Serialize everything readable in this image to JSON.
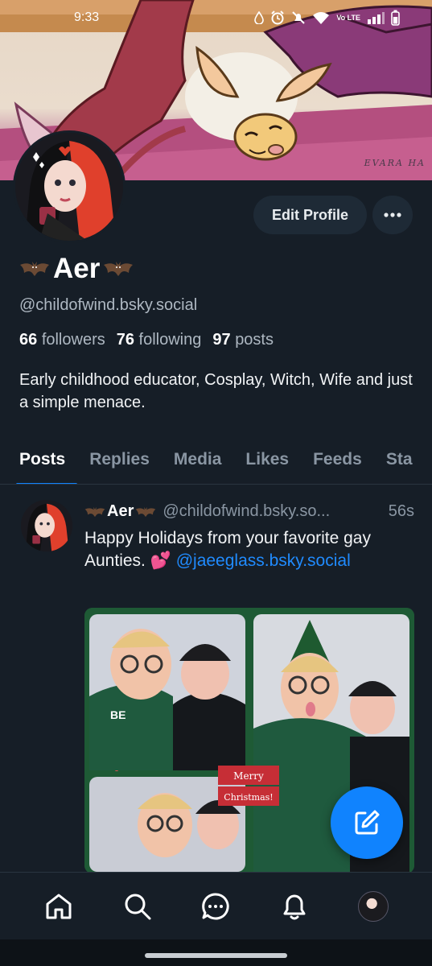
{
  "status_bar": {
    "time": "9:33",
    "network_label": "Vo LTE"
  },
  "banner": {
    "credit": "EVARA HA"
  },
  "profile": {
    "display_name": "Aer",
    "name_emoji": "bat-emoji",
    "handle": "@childofwind.bsky.social",
    "followers_count": "66",
    "followers_label": "followers",
    "following_count": "76",
    "following_label": "following",
    "posts_count": "97",
    "posts_label": "posts",
    "bio": "Early childhood educator, Cosplay, Witch, Wife and just a simple menace."
  },
  "actions": {
    "edit_profile": "Edit Profile",
    "more_icon": "ellipsis-icon"
  },
  "tabs": [
    {
      "label": "Posts",
      "active": true
    },
    {
      "label": "Replies"
    },
    {
      "label": "Media"
    },
    {
      "label": "Likes"
    },
    {
      "label": "Feeds"
    },
    {
      "label": "Sta"
    }
  ],
  "post": {
    "author": "Aer",
    "handle": "@childofwind.bsky.so...",
    "time": "56s",
    "text": "Happy Holidays from your favorite gay Aunties. 💕",
    "mention": "@jaeeglass.bsky.social",
    "image_text_1": "Merry",
    "image_text_2": "Christmas!",
    "sweater_text": "BE"
  },
  "nav": [
    "home-icon",
    "search-icon",
    "chat-icon",
    "notifications-icon",
    "profile-avatar"
  ],
  "colors": {
    "background": "#161e27",
    "accent": "#1083fe",
    "muted": "#8a96a3",
    "button": "#1e2a36"
  }
}
